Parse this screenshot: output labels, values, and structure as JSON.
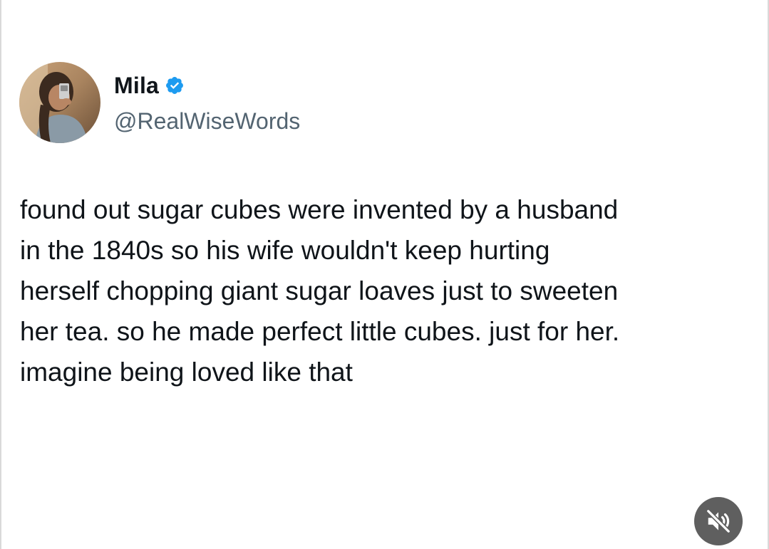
{
  "author": {
    "display_name": "Mila",
    "handle": "@RealWiseWords",
    "verified_icon": "verified-badge-icon",
    "verified_color": "#1d9bf0"
  },
  "tweet": {
    "lines": [
      "found out sugar cubes were invented by a husband",
      "in the 1840s so his wife wouldn't keep hurting",
      "herself chopping giant sugar loaves just to sweeten",
      "her tea. so he made perfect little cubes. just for her.",
      "imagine being loved like that"
    ]
  },
  "controls": {
    "mute_icon": "speaker-muted-icon"
  }
}
